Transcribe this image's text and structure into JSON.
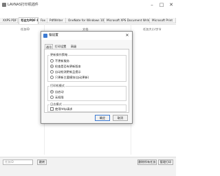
{
  "window": {
    "title": "LAVNAS打印机插件",
    "minimize_icon": "minimize-icon",
    "maximize_icon": "maximize-icon",
    "close_icon": "close-icon"
  },
  "tabs": [
    {
      "label": "XXPS PDF",
      "active": false
    },
    {
      "label": "写这为PDF PDF",
      "active": true
    },
    {
      "label": "Fax",
      "active": false
    },
    {
      "label": "PdfWriter",
      "active": false
    },
    {
      "label": "OneNote for Windows 10",
      "active": false
    },
    {
      "label": "Microsoft XPS Document Writer",
      "active": false
    },
    {
      "label": "Microsoft Print",
      "active": false
    }
  ],
  "columns": {
    "left": "任务ID",
    "center": "文档",
    "right": "任务大小/字节"
  },
  "bottom": {
    "input_placeholder": "任务ID",
    "go_button": "跳转",
    "clear_button": "删除所有任务",
    "settings_button": "管理打印"
  },
  "dialog": {
    "title": "偏设置",
    "close_icon": "close-icon",
    "tabs": [
      {
        "label": "通用",
        "active": true
      },
      {
        "label": "打印设置",
        "active": false
      },
      {
        "label": "高级",
        "active": false
      }
    ],
    "group1": {
      "label": "更新操作策略",
      "options": [
        {
          "label": "不更新服务",
          "checked": false
        },
        {
          "label": "检查是否有更新版本",
          "checked": true
        },
        {
          "label": "自动检测更新且提示",
          "checked": false
        },
        {
          "label": "只更新主要模块(自动更新)",
          "checked": false
        }
      ]
    },
    "group2": {
      "label": "打印机模式",
      "options": [
        {
          "label": "自启动",
          "checked": true
        },
        {
          "label": "无权限",
          "checked": false
        }
      ]
    },
    "group3": {
      "label": "日志模式",
      "options": [
        {
          "label": "使用http请求",
          "checked": false
        }
      ]
    },
    "ok_button": "确定",
    "cancel_button": "取消"
  },
  "colors": {
    "accent": "#3d7bd3",
    "window_bg": "#ffffff",
    "toolbar_bg": "#f2f2f2"
  }
}
